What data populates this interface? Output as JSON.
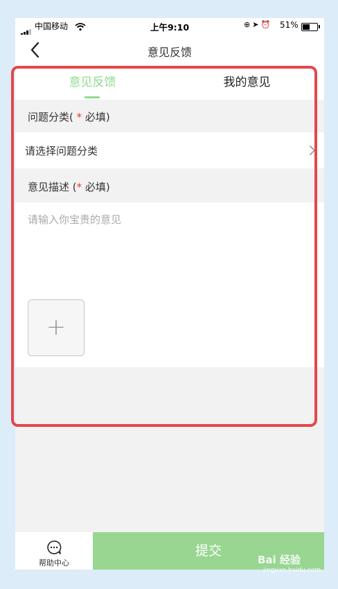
{
  "status_bar": {
    "carrier": "中国移动",
    "time": "上午9:10",
    "battery_percent": "51%",
    "battery_level": 0.51
  },
  "nav": {
    "title": "意见反馈",
    "back_icon": "chevron-left-icon"
  },
  "tabs": [
    {
      "label": "意见反馈",
      "active": true
    },
    {
      "label": "我的意见",
      "active": false
    }
  ],
  "form": {
    "category_section": {
      "prefix": "问题分类(",
      "star": " *",
      "suffix": " 必填)"
    },
    "category_select": {
      "label": "请选择问题分类",
      "icon": "chevron-right-icon"
    },
    "description_section": {
      "prefix": "意见描述 (",
      "star": "*",
      "suffix": " 必填)"
    },
    "description_placeholder": "请输入你宝贵的意见",
    "add_image_symbol": "+"
  },
  "bottom_bar": {
    "help_label": "帮助中心",
    "help_icon": "chat-bubble-icon",
    "submit_label": "提交"
  },
  "watermark": {
    "text": "Bai 经验",
    "sub": "jingyan.baidu.com"
  },
  "colors": {
    "accent": "#8fdc8f",
    "submit": "#98d692",
    "highlight": "#e5464a",
    "required": "#e53935",
    "frame": "#dcecf8"
  }
}
